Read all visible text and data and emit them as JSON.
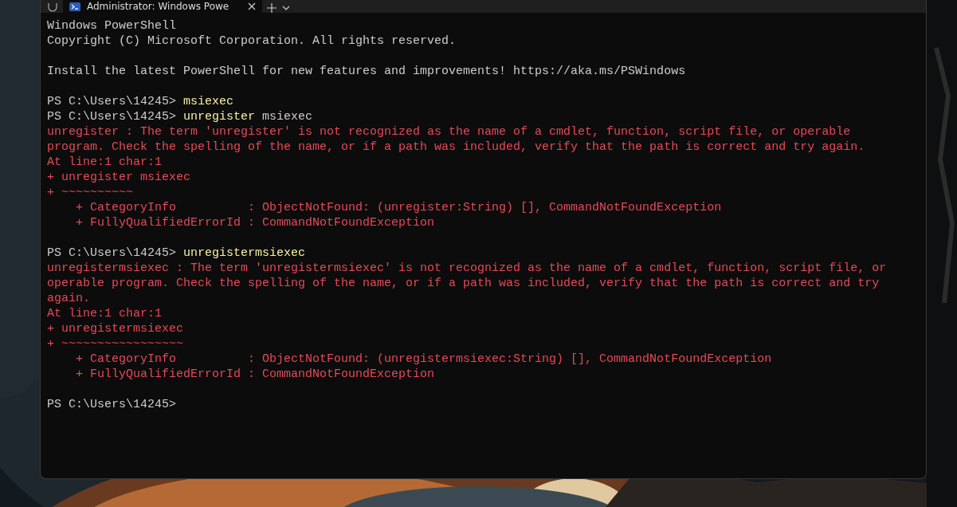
{
  "window": {
    "tab_title": "Administrator: Windows Powe",
    "tab_selected": true
  },
  "lines": [
    {
      "kind": "output",
      "segments": [
        {
          "kind": "normal",
          "text": "Windows PowerShell"
        }
      ]
    },
    {
      "kind": "output",
      "segments": [
        {
          "kind": "normal",
          "text": "Copyright (C) Microsoft Corporation. All rights reserved."
        }
      ]
    },
    {
      "kind": "blank"
    },
    {
      "kind": "output",
      "segments": [
        {
          "kind": "normal",
          "text": "Install the latest PowerShell for new features and improvements! https://aka.ms/PSWindows"
        }
      ]
    },
    {
      "kind": "blank"
    },
    {
      "kind": "prompt",
      "segments": [
        {
          "kind": "normal",
          "text": "PS C:\\Users\\14245> "
        },
        {
          "kind": "command",
          "text": "msiexec"
        }
      ]
    },
    {
      "kind": "prompt",
      "segments": [
        {
          "kind": "normal",
          "text": "PS C:\\Users\\14245> "
        },
        {
          "kind": "command",
          "text": "unregister"
        },
        {
          "kind": "normal",
          "text": " msiexec"
        }
      ]
    },
    {
      "kind": "output",
      "segments": [
        {
          "kind": "error",
          "text": "unregister : The term 'unregister' is not recognized as the name of a cmdlet, function, script file, or operable"
        }
      ]
    },
    {
      "kind": "output",
      "segments": [
        {
          "kind": "error",
          "text": "program. Check the spelling of the name, or if a path was included, verify that the path is correct and try again."
        }
      ]
    },
    {
      "kind": "output",
      "segments": [
        {
          "kind": "error",
          "text": "At line:1 char:1"
        }
      ]
    },
    {
      "kind": "output",
      "segments": [
        {
          "kind": "error",
          "text": "+ unregister msiexec"
        }
      ]
    },
    {
      "kind": "output",
      "segments": [
        {
          "kind": "error",
          "text": "+ ~~~~~~~~~~"
        }
      ]
    },
    {
      "kind": "output",
      "segments": [
        {
          "kind": "error",
          "text": "    + CategoryInfo          : ObjectNotFound: (unregister:String) [], CommandNotFoundException"
        }
      ]
    },
    {
      "kind": "output",
      "segments": [
        {
          "kind": "error",
          "text": "    + FullyQualifiedErrorId : CommandNotFoundException"
        }
      ]
    },
    {
      "kind": "blank"
    },
    {
      "kind": "prompt",
      "segments": [
        {
          "kind": "normal",
          "text": "PS C:\\Users\\14245> "
        },
        {
          "kind": "command",
          "text": "unregistermsiexec"
        }
      ]
    },
    {
      "kind": "output",
      "segments": [
        {
          "kind": "error",
          "text": "unregistermsiexec : The term 'unregistermsiexec' is not recognized as the name of a cmdlet, function, script file, or"
        }
      ]
    },
    {
      "kind": "output",
      "segments": [
        {
          "kind": "error",
          "text": "operable program. Check the spelling of the name, or if a path was included, verify that the path is correct and try"
        }
      ]
    },
    {
      "kind": "output",
      "segments": [
        {
          "kind": "error",
          "text": "again."
        }
      ]
    },
    {
      "kind": "output",
      "segments": [
        {
          "kind": "error",
          "text": "At line:1 char:1"
        }
      ]
    },
    {
      "kind": "output",
      "segments": [
        {
          "kind": "error",
          "text": "+ unregistermsiexec"
        }
      ]
    },
    {
      "kind": "output",
      "segments": [
        {
          "kind": "error",
          "text": "+ ~~~~~~~~~~~~~~~~~"
        }
      ]
    },
    {
      "kind": "output",
      "segments": [
        {
          "kind": "error",
          "text": "    + CategoryInfo          : ObjectNotFound: (unregistermsiexec:String) [], CommandNotFoundException"
        }
      ]
    },
    {
      "kind": "output",
      "segments": [
        {
          "kind": "error",
          "text": "    + FullyQualifiedErrorId : CommandNotFoundException"
        }
      ]
    },
    {
      "kind": "blank"
    },
    {
      "kind": "prompt",
      "segments": [
        {
          "kind": "normal",
          "text": "PS C:\\Users\\14245>"
        }
      ]
    }
  ]
}
